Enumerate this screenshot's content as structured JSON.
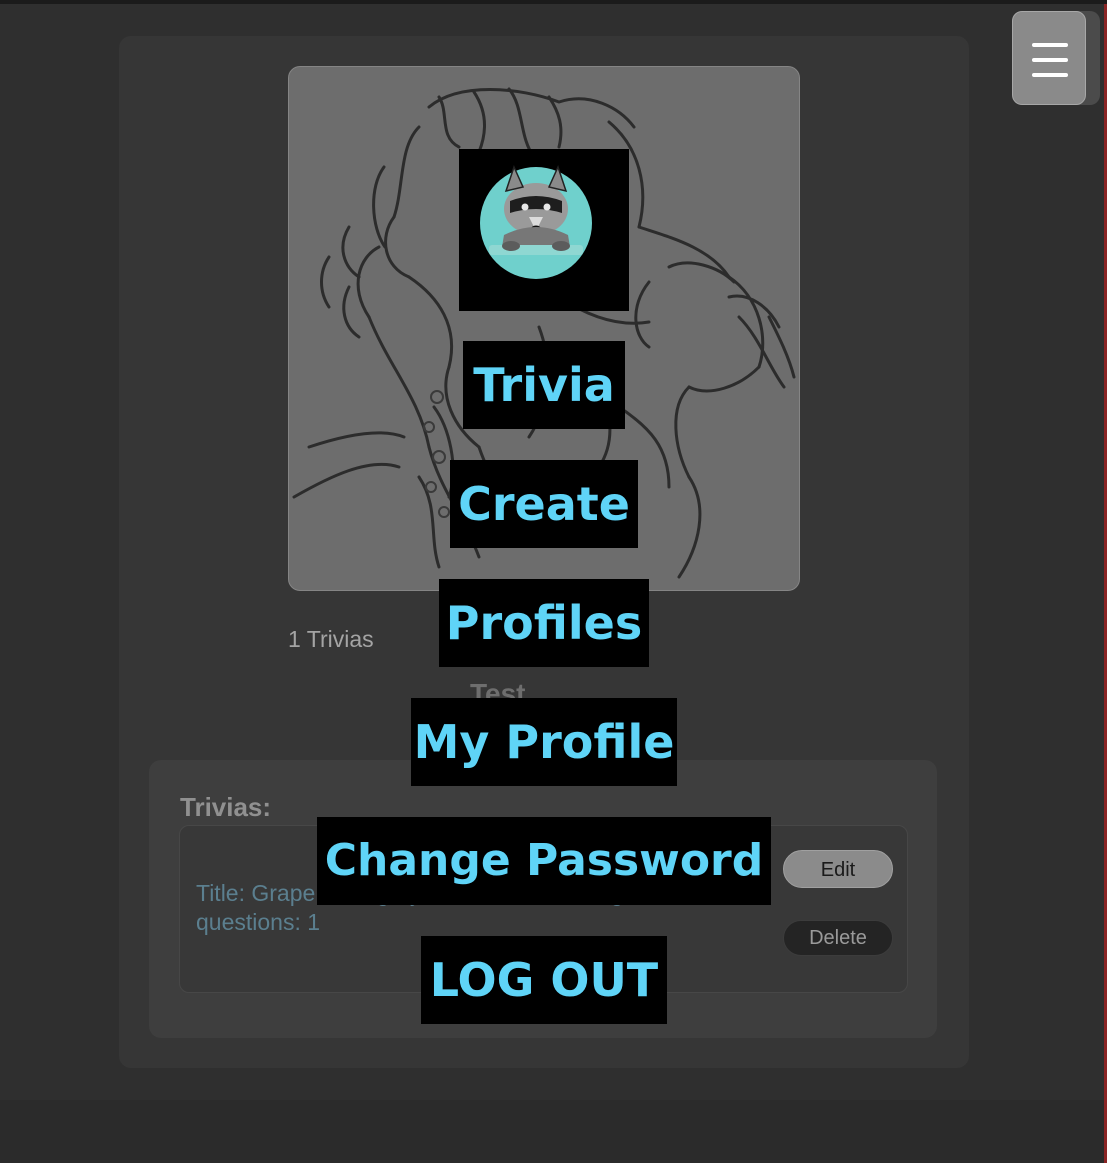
{
  "profile": {
    "trivia_count": "1 Trivias",
    "name_fragment": "Test"
  },
  "trivias_section": {
    "heading": "Trivias:",
    "items": [
      {
        "description": "Title: Grape; Category: General Knowledge; Number of questions: 1",
        "edit_label": "Edit",
        "delete_label": "Delete"
      }
    ]
  },
  "nav_menu": {
    "toggle_icon": "hamburger-icon",
    "logo_icon": "raccoon-logo",
    "items": [
      {
        "label": "Trivia"
      },
      {
        "label": "Create"
      },
      {
        "label": "Profiles"
      },
      {
        "label": "My Profile"
      },
      {
        "label": "Change Password"
      },
      {
        "label": "LOG OUT"
      }
    ]
  },
  "colors": {
    "menu_text": "#5fd4f7",
    "menu_background": "#000000",
    "page_background": "#2f2f2f",
    "card_background": "#363636",
    "logo_circle": "#6fd0cc"
  }
}
